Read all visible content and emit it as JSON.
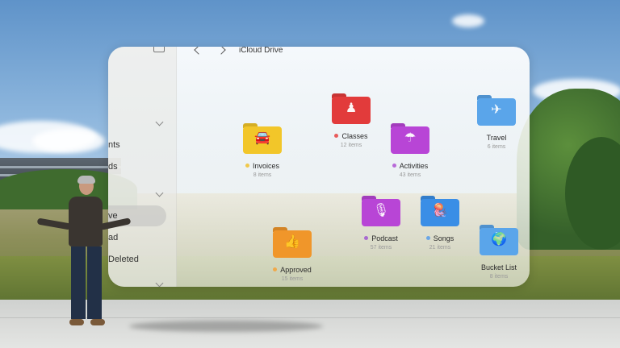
{
  "window": {
    "title": "iCloud Drive"
  },
  "sidebar": {
    "items": [
      {
        "label": "nts"
      },
      {
        "label": "ds"
      },
      {
        "label": "ve"
      },
      {
        "label": "ad"
      },
      {
        "label": "Deleted"
      }
    ]
  },
  "folders": [
    {
      "name": "Classes",
      "count": "12 items",
      "color": "#e23b3b",
      "dot": "#e85b5b",
      "icon": "person-teaching-icon"
    },
    {
      "name": "Travel",
      "count": "6 items",
      "color": "#5aa5ea",
      "dot": null,
      "icon": "airplane-icon"
    },
    {
      "name": "Invoices",
      "count": "8 items",
      "color": "#f2c629",
      "dot": "#f0c84a",
      "icon": "car-icon"
    },
    {
      "name": "Activities",
      "count": "43 items",
      "color": "#b845d6",
      "dot": "#b86ad8",
      "icon": "umbrella-icon"
    },
    {
      "name": "Podcast",
      "count": "57 items",
      "color": "#b845d6",
      "dot": "#a86ad0",
      "icon": "podcast-icon"
    },
    {
      "name": "Songs",
      "count": "21 items",
      "color": "#3a8ee6",
      "dot": "#6aa6e6",
      "icon": "jellyfish-icon"
    },
    {
      "name": "Approved",
      "count": "15 items",
      "color": "#f0962a",
      "dot": "#f0a94a",
      "icon": "thumbs-up-icon"
    },
    {
      "name": "Bucket List",
      "count": "8 items",
      "color": "#5aa5ea",
      "dot": null,
      "icon": "globe-icon"
    }
  ],
  "glyphs": {
    "person-teaching-icon": "♟",
    "airplane-icon": "✈",
    "car-icon": "🚘",
    "umbrella-icon": "☂",
    "podcast-icon": "🎙",
    "jellyfish-icon": "🪼",
    "thumbs-up-icon": "👍",
    "globe-icon": "🌍"
  }
}
